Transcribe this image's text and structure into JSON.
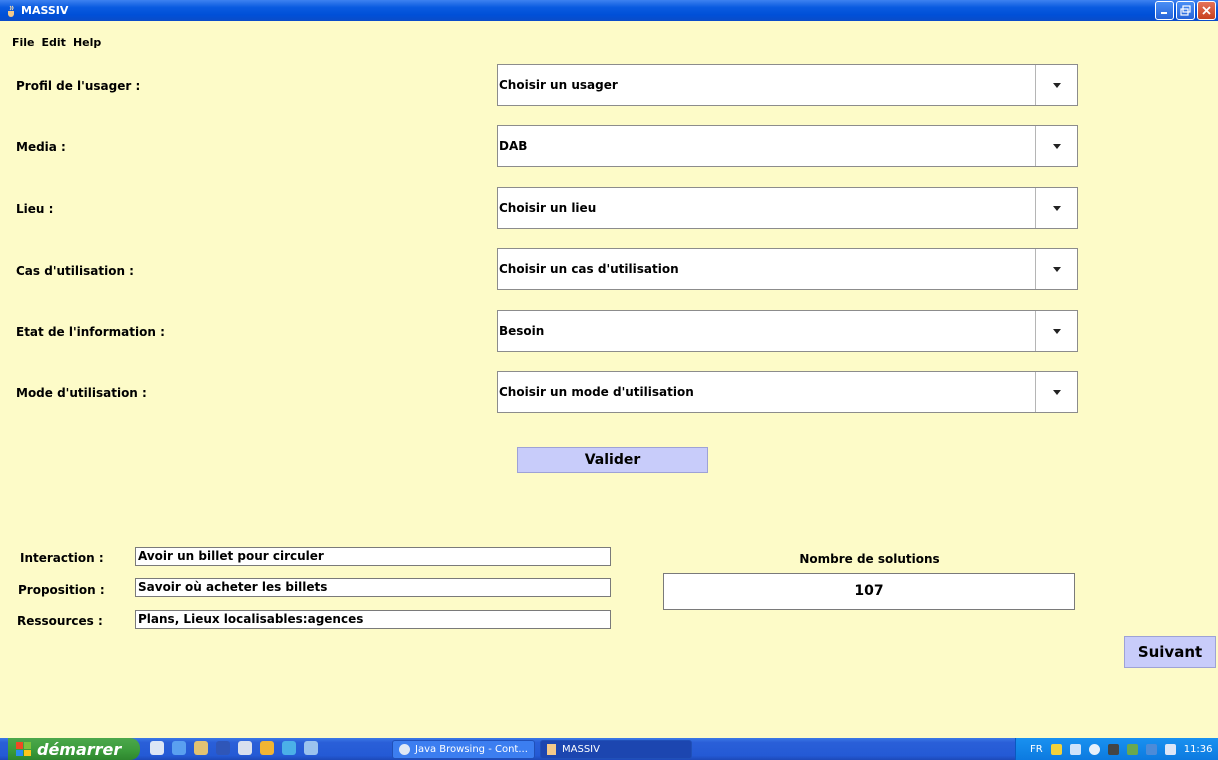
{
  "window": {
    "title": "MASSIV"
  },
  "menu": {
    "items": [
      "File",
      "Edit",
      "Help"
    ]
  },
  "form": {
    "rows": [
      {
        "label": "Profil de l'usager :",
        "value": "Choisir un usager"
      },
      {
        "label": "Media :",
        "value": "DAB"
      },
      {
        "label": "Lieu :",
        "value": "Choisir un lieu"
      },
      {
        "label": "Cas d'utilisation :",
        "value": "Choisir un cas d'utilisation"
      },
      {
        "label": "Etat de l'information :",
        "value": "Besoin"
      },
      {
        "label": "Mode d'utilisation :",
        "value": "Choisir un mode d'utilisation"
      }
    ],
    "validate_label": "Valider"
  },
  "results": {
    "interaction_label": "Interaction :",
    "interaction_value": "Avoir un billet pour circuler",
    "proposition_label": "Proposition :",
    "proposition_value": "Savoir où acheter les billets",
    "ressources_label": "Ressources :",
    "ressources_value": "Plans, Lieux localisables:agences",
    "solutions_title": "Nombre de solutions",
    "solutions_count": "107",
    "next_label": "Suivant"
  },
  "taskbar": {
    "start_label": "démarrer",
    "tasks": [
      "Java Browsing - Cont...",
      "MASSIV"
    ],
    "tray_lang": "FR",
    "clock": "11:36"
  },
  "colors": {
    "background": "#fdfbc8",
    "button": "#c8ccfa",
    "titlebar": "#0a5be0"
  }
}
